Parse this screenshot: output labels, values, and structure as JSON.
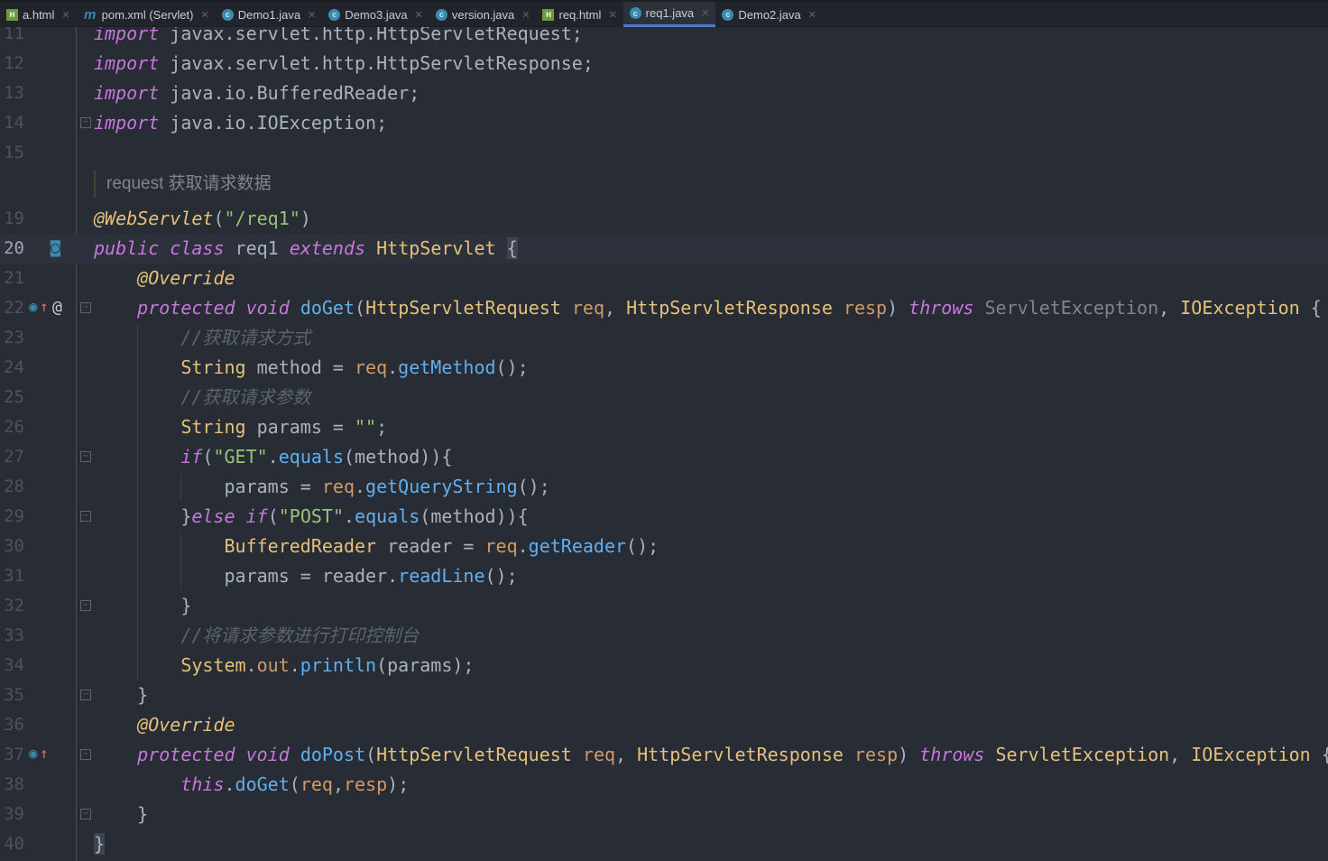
{
  "tabs": [
    {
      "label": "a.html",
      "icon": "html-file-icon",
      "type": "h"
    },
    {
      "label": "pom.xml (Servlet)",
      "icon": "maven-icon",
      "type": "m"
    },
    {
      "label": "Demo1.java",
      "icon": "class-icon",
      "type": "c"
    },
    {
      "label": "Demo3.java",
      "icon": "class-icon",
      "type": "c"
    },
    {
      "label": "version.java",
      "icon": "class-icon",
      "type": "c"
    },
    {
      "label": "req.html",
      "icon": "html-file-icon",
      "type": "h"
    },
    {
      "label": "req1.java",
      "icon": "class-icon",
      "type": "c",
      "active": true
    },
    {
      "label": "Demo2.java",
      "icon": "class-icon",
      "type": "c"
    }
  ],
  "doc_comment": "request 获取请求数据",
  "current_line": "20",
  "lines": [
    {
      "n": "11",
      "t": [
        [
          "import",
          "kw"
        ],
        [
          " javax.servlet.http.HttpServletRequest;",
          "pl"
        ]
      ]
    },
    {
      "n": "12",
      "t": [
        [
          "import",
          "kw"
        ],
        [
          " javax.servlet.http.HttpServletResponse;",
          "pl"
        ]
      ]
    },
    {
      "n": "13",
      "t": [
        [
          "import",
          "kw"
        ],
        [
          " java.io.BufferedReader;",
          "pl"
        ]
      ]
    },
    {
      "n": "14",
      "t": [
        [
          "import",
          "kw"
        ],
        [
          " java.io.IOException;",
          "pl"
        ]
      ]
    },
    {
      "n": "15",
      "t": []
    },
    {
      "n": "19",
      "t": [
        [
          "@WebServlet",
          "an"
        ],
        [
          "(",
          "pl"
        ],
        [
          "\"/req1\"",
          "str"
        ],
        [
          ")",
          "pl"
        ]
      ]
    },
    {
      "n": "20",
      "t": [
        [
          "public",
          "kw"
        ],
        [
          " ",
          "pl"
        ],
        [
          "class",
          "kw"
        ],
        [
          " req1 ",
          "pl"
        ],
        [
          "extends",
          "kw"
        ],
        [
          " ",
          "pl"
        ],
        [
          "HttpServlet",
          "ty"
        ],
        [
          " ",
          "pl"
        ],
        [
          "{",
          "br"
        ]
      ]
    },
    {
      "n": "21",
      "t": [
        [
          "    ",
          "pl"
        ],
        [
          "@Override",
          "an"
        ]
      ]
    },
    {
      "n": "22",
      "t": [
        [
          "    ",
          "pl"
        ],
        [
          "protected",
          "kw"
        ],
        [
          " ",
          "pl"
        ],
        [
          "void",
          "kw"
        ],
        [
          " ",
          "pl"
        ],
        [
          "doGet",
          "fn"
        ],
        [
          "(",
          "pl"
        ],
        [
          "HttpServletRequest",
          "ty"
        ],
        [
          " ",
          "pl"
        ],
        [
          "req",
          "pa"
        ],
        [
          ", ",
          "pl"
        ],
        [
          "HttpServletResponse",
          "ty"
        ],
        [
          " ",
          "pl"
        ],
        [
          "resp",
          "pa"
        ],
        [
          ") ",
          "pl"
        ],
        [
          "throws",
          "kw"
        ],
        [
          " ",
          "pl"
        ],
        [
          "ServletException",
          "gy"
        ],
        [
          ", ",
          "pl"
        ],
        [
          "IOException",
          "ty"
        ],
        [
          " {",
          "pl"
        ]
      ]
    },
    {
      "n": "23",
      "t": [
        [
          "        ",
          "pl"
        ],
        [
          "//获取请求方式",
          "cm"
        ]
      ]
    },
    {
      "n": "24",
      "t": [
        [
          "        ",
          "pl"
        ],
        [
          "String",
          "ty"
        ],
        [
          " method = ",
          "pl"
        ],
        [
          "req",
          "pa"
        ],
        [
          ".",
          "pl"
        ],
        [
          "getMethod",
          "fn"
        ],
        [
          "();",
          "pl"
        ]
      ]
    },
    {
      "n": "25",
      "t": [
        [
          "        ",
          "pl"
        ],
        [
          "//获取请求参数",
          "cm"
        ]
      ]
    },
    {
      "n": "26",
      "t": [
        [
          "        ",
          "pl"
        ],
        [
          "String",
          "ty"
        ],
        [
          " params = ",
          "pl"
        ],
        [
          "\"\"",
          "str"
        ],
        [
          ";",
          "pl"
        ]
      ]
    },
    {
      "n": "27",
      "t": [
        [
          "        ",
          "pl"
        ],
        [
          "if",
          "kw"
        ],
        [
          "(",
          "pl"
        ],
        [
          "\"GET\"",
          "str"
        ],
        [
          ".",
          "pl"
        ],
        [
          "equals",
          "fn"
        ],
        [
          "(method)){",
          "pl"
        ]
      ]
    },
    {
      "n": "28",
      "t": [
        [
          "            params = ",
          "pl"
        ],
        [
          "req",
          "pa"
        ],
        [
          ".",
          "pl"
        ],
        [
          "getQueryString",
          "fn"
        ],
        [
          "();",
          "pl"
        ]
      ]
    },
    {
      "n": "29",
      "t": [
        [
          "        }",
          "pl"
        ],
        [
          "else",
          "kw"
        ],
        [
          " ",
          "pl"
        ],
        [
          "if",
          "kw"
        ],
        [
          "(",
          "pl"
        ],
        [
          "\"POST\"",
          "str"
        ],
        [
          ".",
          "pl"
        ],
        [
          "equals",
          "fn"
        ],
        [
          "(method)){",
          "pl"
        ]
      ]
    },
    {
      "n": "30",
      "t": [
        [
          "            ",
          "pl"
        ],
        [
          "BufferedReader",
          "ty"
        ],
        [
          " reader = ",
          "pl"
        ],
        [
          "req",
          "pa"
        ],
        [
          ".",
          "pl"
        ],
        [
          "getReader",
          "fn"
        ],
        [
          "();",
          "pl"
        ]
      ]
    },
    {
      "n": "31",
      "t": [
        [
          "            params = reader.",
          "pl"
        ],
        [
          "readLine",
          "fn"
        ],
        [
          "();",
          "pl"
        ]
      ]
    },
    {
      "n": "32",
      "t": [
        [
          "        }",
          "pl"
        ]
      ]
    },
    {
      "n": "33",
      "t": [
        [
          "        ",
          "pl"
        ],
        [
          "//将请求参数进行打印控制台",
          "cm"
        ]
      ]
    },
    {
      "n": "34",
      "t": [
        [
          "        ",
          "pl"
        ],
        [
          "System",
          "ty"
        ],
        [
          ".",
          "pl"
        ],
        [
          "out",
          "pa"
        ],
        [
          ".",
          "pl"
        ],
        [
          "println",
          "fn"
        ],
        [
          "(params);",
          "pl"
        ]
      ]
    },
    {
      "n": "35",
      "t": [
        [
          "    }",
          "pl"
        ]
      ]
    },
    {
      "n": "36",
      "t": [
        [
          "    ",
          "pl"
        ],
        [
          "@Override",
          "an"
        ]
      ]
    },
    {
      "n": "37",
      "t": [
        [
          "    ",
          "pl"
        ],
        [
          "protected",
          "kw"
        ],
        [
          " ",
          "pl"
        ],
        [
          "void",
          "kw"
        ],
        [
          " ",
          "pl"
        ],
        [
          "doPost",
          "fn"
        ],
        [
          "(",
          "pl"
        ],
        [
          "HttpServletRequest",
          "ty"
        ],
        [
          " ",
          "pl"
        ],
        [
          "req",
          "pa"
        ],
        [
          ", ",
          "pl"
        ],
        [
          "HttpServletResponse",
          "ty"
        ],
        [
          " ",
          "pl"
        ],
        [
          "resp",
          "pa"
        ],
        [
          ") ",
          "pl"
        ],
        [
          "throws",
          "kw"
        ],
        [
          " ",
          "pl"
        ],
        [
          "ServletException",
          "ty"
        ],
        [
          ", ",
          "pl"
        ],
        [
          "IOException",
          "ty"
        ],
        [
          " {",
          "pl"
        ]
      ]
    },
    {
      "n": "38",
      "t": [
        [
          "        ",
          "pl"
        ],
        [
          "this",
          "kw"
        ],
        [
          ".",
          "pl"
        ],
        [
          "doGet",
          "fn"
        ],
        [
          "(",
          "pl"
        ],
        [
          "req",
          "pa"
        ],
        [
          ",",
          "pl"
        ],
        [
          "resp",
          "pa"
        ],
        [
          ");",
          "pl"
        ]
      ]
    },
    {
      "n": "39",
      "t": [
        [
          "    }",
          "pl"
        ]
      ]
    },
    {
      "n": "40",
      "t": [
        [
          "}",
          "br"
        ]
      ]
    }
  ]
}
